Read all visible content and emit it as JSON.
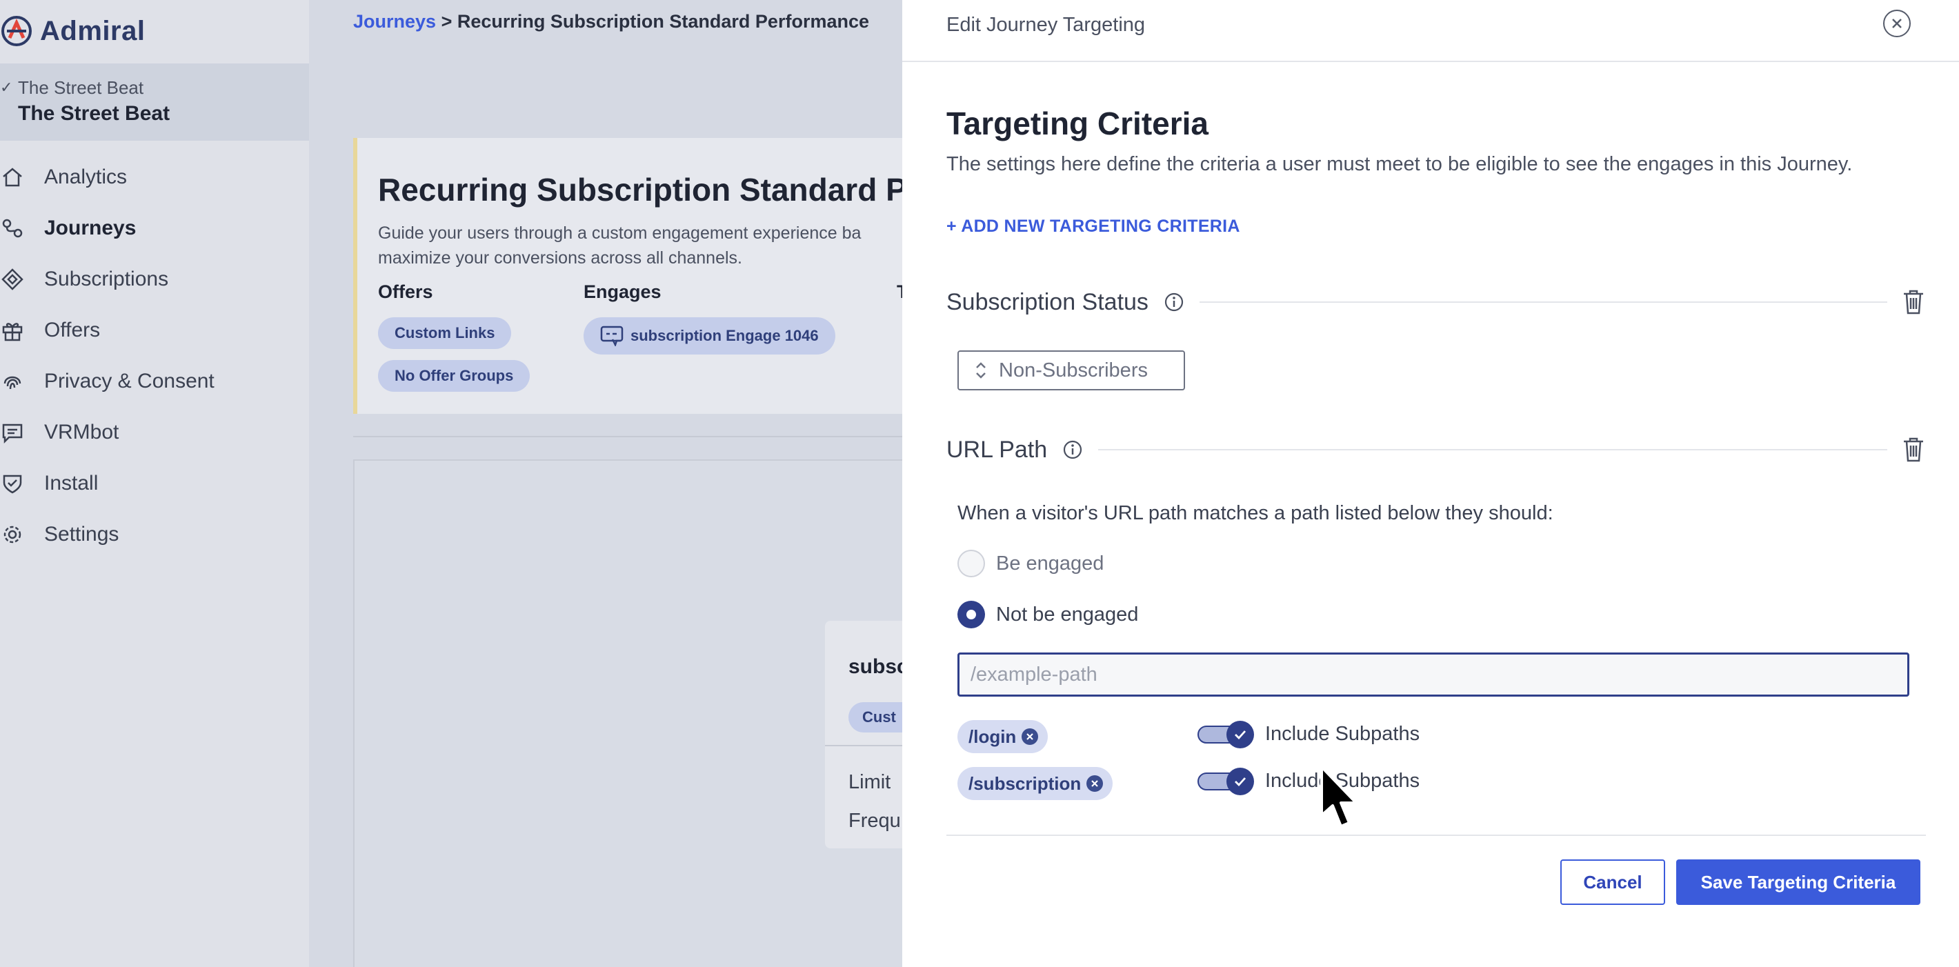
{
  "app": {
    "name": "Admiral"
  },
  "org": {
    "selector_label": "The Street Beat",
    "name": "The Street Beat"
  },
  "sidebar": {
    "items": [
      {
        "label": "Analytics",
        "icon": "home-icon",
        "active": false
      },
      {
        "label": "Journeys",
        "icon": "journeys-icon",
        "active": true
      },
      {
        "label": "Subscriptions",
        "icon": "subscriptions-icon",
        "active": false
      },
      {
        "label": "Offers",
        "icon": "gift-icon",
        "active": false
      },
      {
        "label": "Privacy & Consent",
        "icon": "fingerprint-icon",
        "active": false
      },
      {
        "label": "VRMbot",
        "icon": "chat-icon",
        "active": false
      },
      {
        "label": "Install",
        "icon": "shield-icon",
        "active": false
      },
      {
        "label": "Settings",
        "icon": "gear-icon",
        "active": false
      }
    ]
  },
  "breadcrumb": {
    "parent": "Journeys",
    "separator": ">",
    "current": "Recurring Subscription Standard Performance"
  },
  "journey_card": {
    "title": "Recurring Subscription Standard P",
    "description": "Guide your users through a custom engagement experience ba maximize your conversions across all channels.",
    "offers_label": "Offers",
    "offers": [
      "Custom Links",
      "No Offer Groups"
    ],
    "engages_label": "Engages",
    "engages": [
      "subscription Engage 1046"
    ],
    "third_label": "T"
  },
  "mini_card": {
    "title": "subsc",
    "chip": "Cust",
    "rows": [
      "Limit",
      "Frequ"
    ]
  },
  "panel": {
    "title": "Edit Journey Targeting",
    "heading": "Targeting Criteria",
    "description": "The settings here define the criteria a user must meet to be eligible to see the engages in this Journey.",
    "add_link": "+ ADD NEW TARGETING CRITERIA",
    "subscription_status": {
      "label": "Subscription Status",
      "selected": "Non-Subscribers"
    },
    "url_path": {
      "label": "URL Path",
      "description": "When a visitor's URL path matches a path listed below they should:",
      "options": [
        {
          "label": "Be engaged",
          "checked": false
        },
        {
          "label": "Not be engaged",
          "checked": true
        }
      ],
      "input_placeholder": "/example-path",
      "input_value": "",
      "paths": [
        {
          "path": "/login",
          "include_subpaths": true,
          "toggle_label": "Include Subpaths"
        },
        {
          "path": "/subscription",
          "include_subpaths": true,
          "toggle_label": "Include Subpaths"
        }
      ]
    },
    "cancel_label": "Cancel",
    "save_label": "Save Targeting Criteria"
  },
  "colors": {
    "accent": "#3b5bdb",
    "navy": "#2f3f8a",
    "chip_bg": "#d6dcf2"
  }
}
